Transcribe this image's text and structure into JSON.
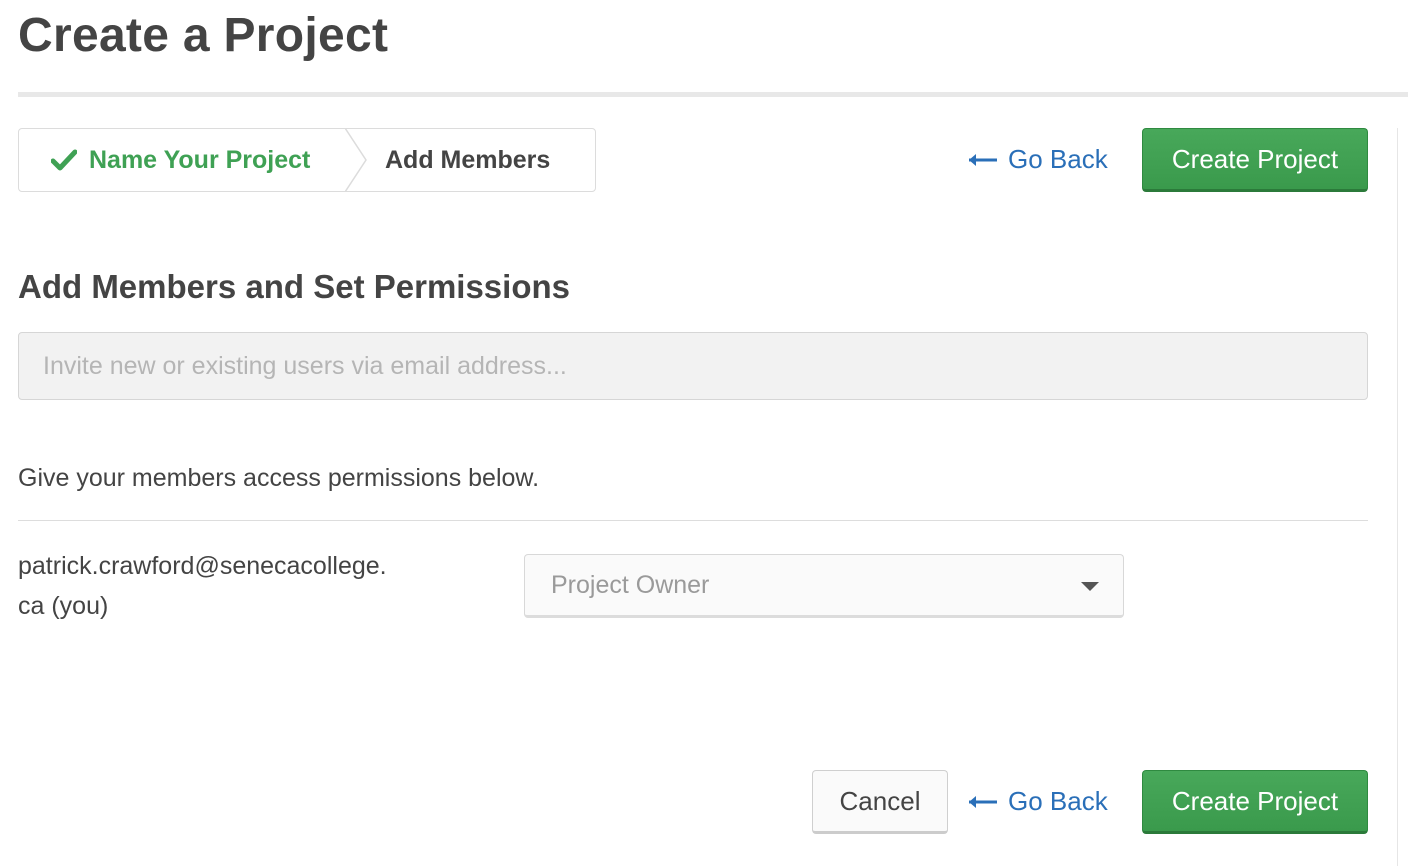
{
  "page": {
    "title": "Create a Project"
  },
  "wizard": {
    "steps": [
      {
        "label": "Name Your Project",
        "state": "completed",
        "icon": "checkmark-icon"
      },
      {
        "label": "Add Members",
        "state": "current"
      }
    ]
  },
  "actions": {
    "go_back_label": "Go Back",
    "create_label": "Create Project",
    "cancel_label": "Cancel",
    "back_icon": "arrow-left-icon"
  },
  "members": {
    "heading": "Add Members and Set Permissions",
    "invite_placeholder": "Invite new or existing users via email address...",
    "permissions_description": "Give your members access permissions below.",
    "list": [
      {
        "email": "patrick.crawford@senecacollege.ca (you)",
        "role": "Project Owner"
      }
    ]
  },
  "colors": {
    "success_green": "#3fa154",
    "primary_button": "#3f9f51",
    "link_blue": "#2a6fb8",
    "heading_text": "#444444"
  }
}
